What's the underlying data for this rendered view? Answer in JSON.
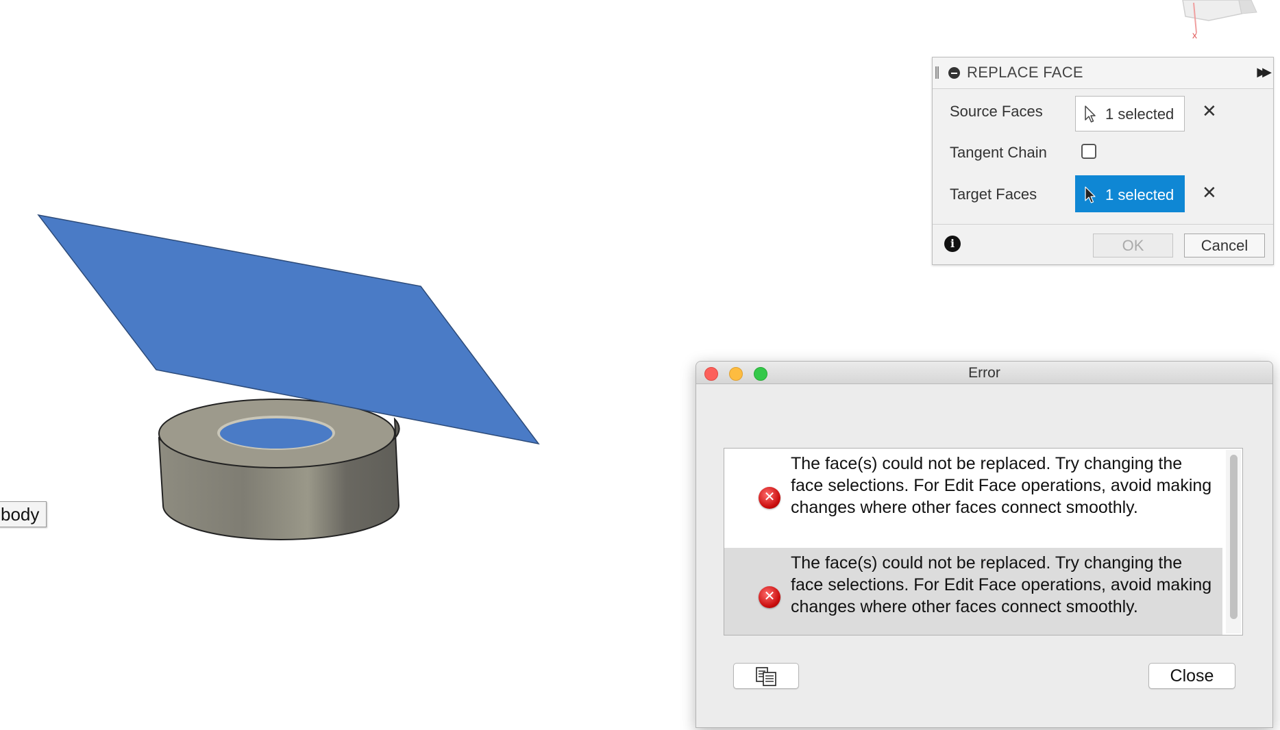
{
  "viewport": {
    "body_label": "body",
    "icons": [
      "viewcube-icon"
    ]
  },
  "replace_face_panel": {
    "title": "REPLACE FACE",
    "icons": [
      "collapse-icon",
      "expand-icon",
      "grip-icon",
      "info-icon",
      "select-cursor-icon",
      "clear-x-icon"
    ],
    "source_faces": {
      "label": "Source Faces",
      "value": "1 selected",
      "clear": "✕"
    },
    "tangent_chain": {
      "label": "Tangent Chain",
      "checked": false
    },
    "target_faces": {
      "label": "Target Faces",
      "value": "1 selected",
      "clear": "✕"
    },
    "info": "i",
    "ok_label": "OK",
    "cancel_label": "Cancel",
    "colors": {
      "active_selection": "#0f87d4"
    }
  },
  "error_dialog": {
    "title": "Error",
    "messages": [
      {
        "text": "The face(s) could not be replaced. Try changing the face selections. For Edit Face operations, avoid making changes where other faces connect smoothly.",
        "icon": "error-icon"
      },
      {
        "text": "The face(s) could not be replaced. Try changing the face selections. For Edit Face operations, avoid making changes where other faces connect smoothly.",
        "icon": "error-icon"
      }
    ],
    "error_glyph": "✕",
    "copy_icon": "copy-icon",
    "close_label": "Close",
    "colors": {
      "error": "#c90d0d",
      "traffic_close": "#fc605b",
      "traffic_min": "#fdbc40",
      "traffic_max": "#34c84a"
    }
  }
}
